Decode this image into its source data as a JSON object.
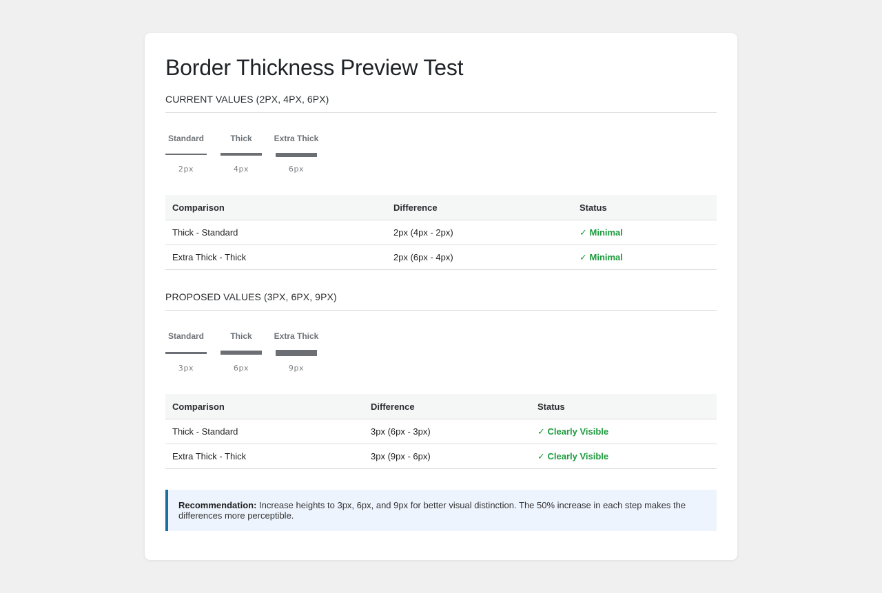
{
  "page_title": "Border Thickness Preview Test",
  "sections": [
    {
      "title": "CURRENT VALUES (2px, 4px, 6px)",
      "samples": [
        {
          "label": "Standard",
          "value": "2px",
          "thickness": 2
        },
        {
          "label": "Thick",
          "value": "4px",
          "thickness": 4
        },
        {
          "label": "Extra Thick",
          "value": "6px",
          "thickness": 6
        }
      ],
      "table": {
        "headers": [
          "Comparison",
          "Difference",
          "Status"
        ],
        "rows": [
          [
            "Thick - Standard",
            "2px (4px - 2px)",
            "✓ Minimal"
          ],
          [
            "Extra Thick - Thick",
            "2px (6px - 4px)",
            "✓ Minimal"
          ]
        ]
      }
    },
    {
      "title": "PROPOSED VALUES (3px, 6px, 9px)",
      "samples": [
        {
          "label": "Standard",
          "value": "3px",
          "thickness": 3
        },
        {
          "label": "Thick",
          "value": "6px",
          "thickness": 6
        },
        {
          "label": "Extra Thick",
          "value": "9px",
          "thickness": 9
        }
      ],
      "table": {
        "headers": [
          "Comparison",
          "Difference",
          "Status"
        ],
        "rows": [
          [
            "Thick - Standard",
            "3px (6px - 3px)",
            "✓ Clearly Visible"
          ],
          [
            "Extra Thick - Thick",
            "3px (9px - 6px)",
            "✓ Clearly Visible"
          ]
        ]
      }
    }
  ],
  "recommendation": {
    "label": "Recommendation:",
    "text": " Increase heights to 3px, 6px, and 9px for better visual distinction. The 50% increase in each step makes the differences more perceptible."
  },
  "colors": {
    "status_ok": "#1c9b3c",
    "bar": "#6b6e73",
    "rec_accent": "#1a6fa0"
  }
}
